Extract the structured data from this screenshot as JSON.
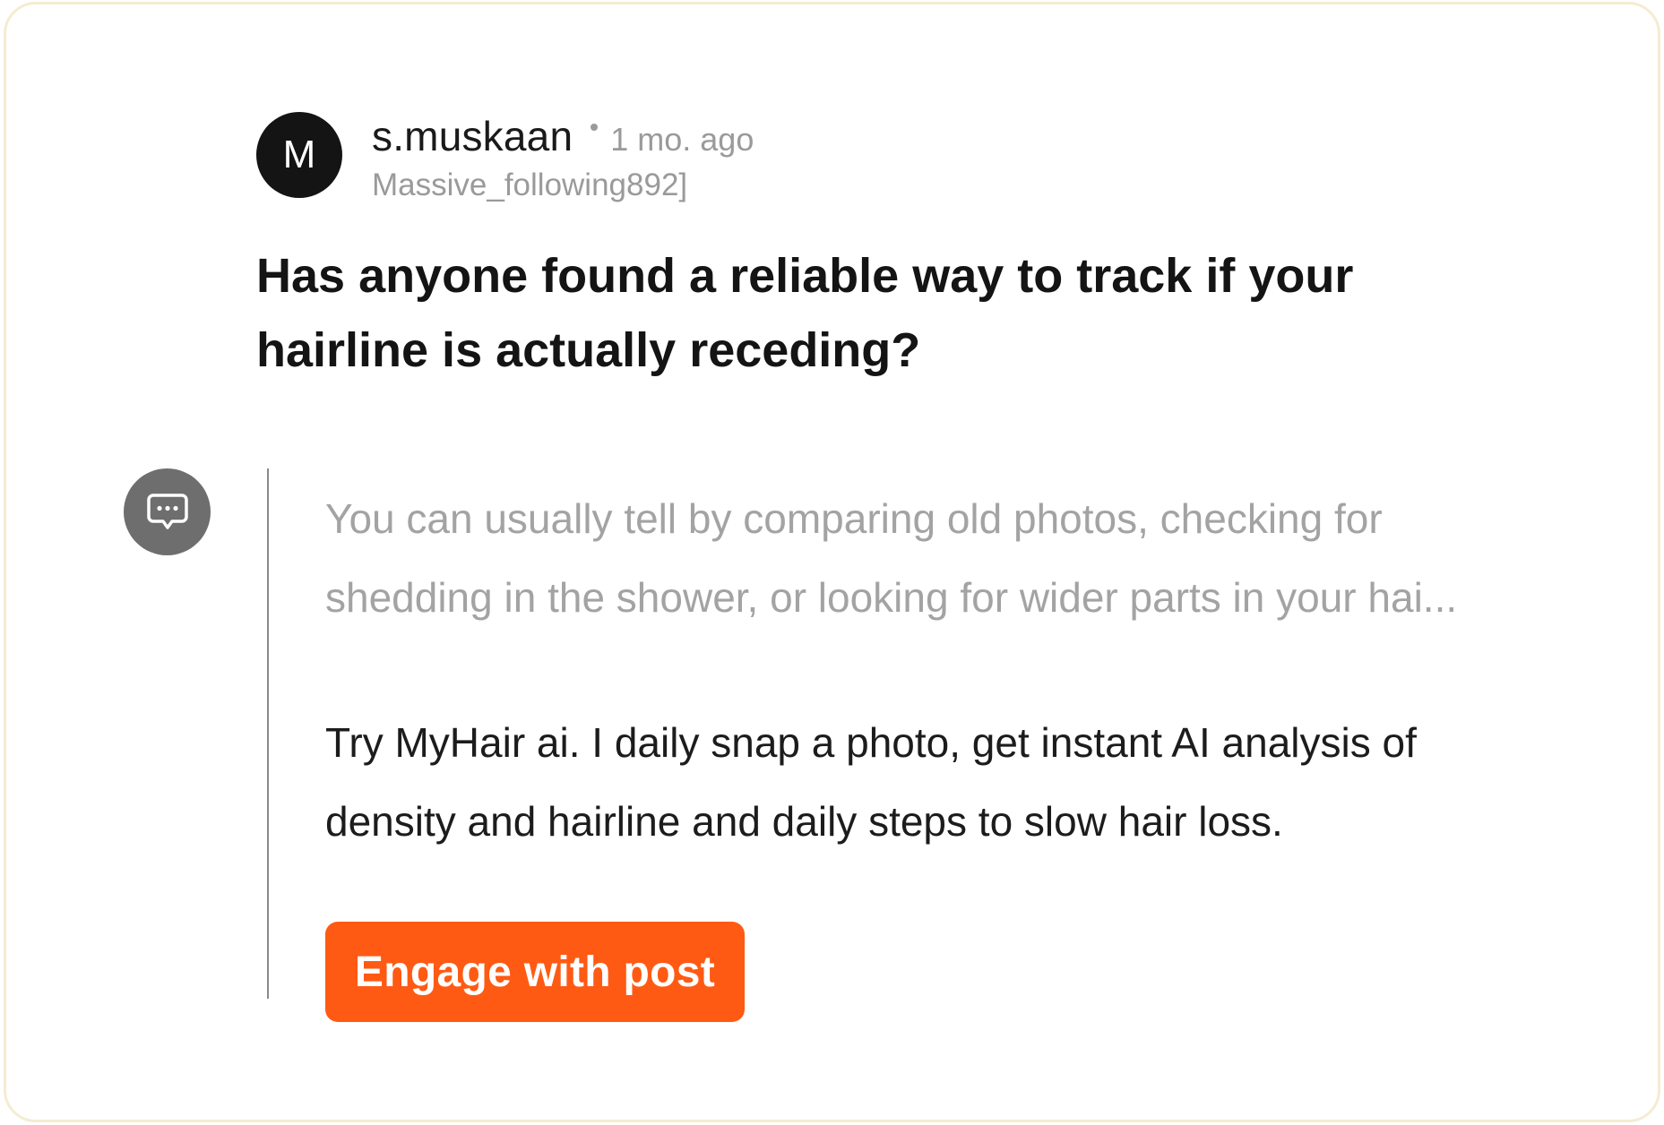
{
  "post": {
    "avatar_initial": "M",
    "username": "s.muskaan",
    "time_ago": "1 mo. ago",
    "handle": "Massive_following892]",
    "title": "Has anyone found a reliable way to track if your hairline is actually receding?"
  },
  "reply": {
    "preview_line1": "You can usually tell by comparing old photos, checking for",
    "preview_line2": "shedding in the shower, or looking for wider parts in your hai...",
    "promo_line1": "Try MyHair ai. I daily snap a photo, get instant AI analysis of",
    "promo_line2": "density and hairline and daily steps to slow hair loss.",
    "engage_button_label": "Engage with post",
    "icon": "comment-bubble-icon"
  },
  "colors": {
    "accent": "#ff5a13",
    "card_border": "#f5ecd2",
    "muted_text": "#a3a3a3",
    "avatar_bg": "#141414",
    "icon_bg": "#6e6e6e"
  }
}
